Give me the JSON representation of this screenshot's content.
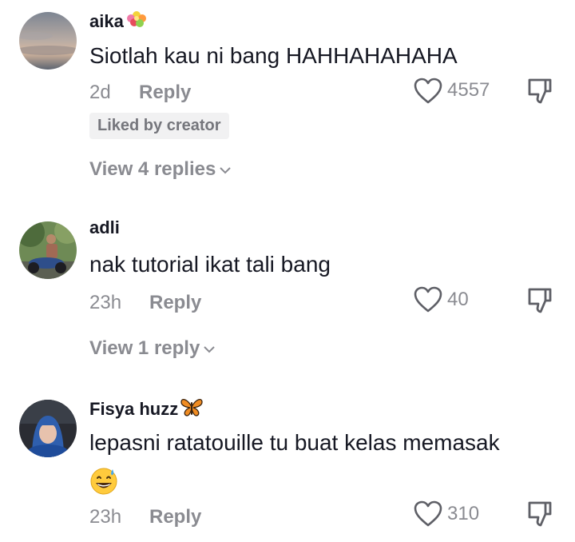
{
  "comments": [
    {
      "username": "aika",
      "username_emoji": "flower-bouquet-emoji",
      "text": "Siotlah kau ni bang HAHHAHAHAHA",
      "time": "2d",
      "reply_label": "Reply",
      "likes": "4557",
      "badge": "Liked by creator",
      "view_replies": "View 4 replies"
    },
    {
      "username": "adli",
      "text": "nak tutorial ikat tali bang",
      "time": "23h",
      "reply_label": "Reply",
      "likes": "40",
      "view_replies": "View 1 reply"
    },
    {
      "username": "Fisya huzz",
      "username_emoji": "butterfly-emoji",
      "text": "lepasni ratatouille tu buat kelas memasak",
      "text_emoji": "grinning-sweat-emoji",
      "time": "23h",
      "reply_label": "Reply",
      "likes": "310"
    }
  ],
  "colors": {
    "primary_text": "#161823",
    "secondary_text": "#8a8b91",
    "badge_bg": "#f1f1f2"
  }
}
